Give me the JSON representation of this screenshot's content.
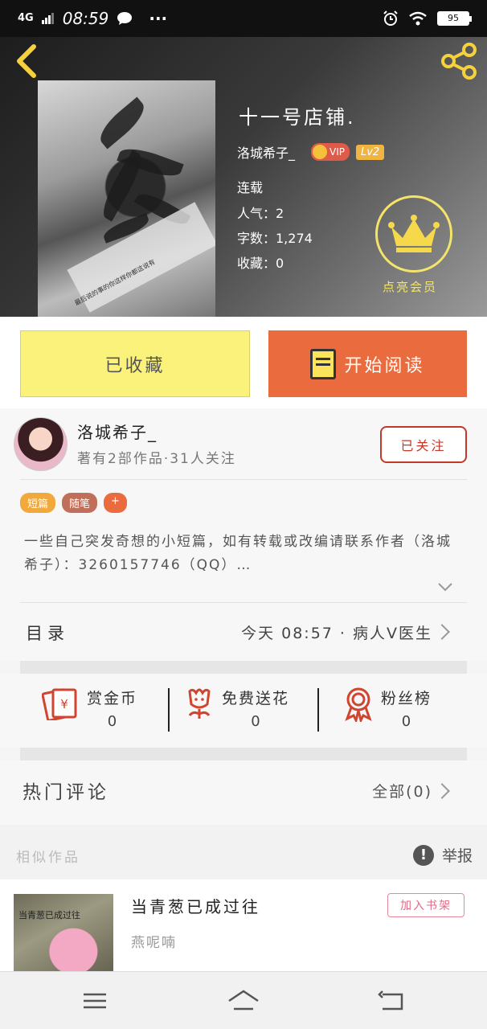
{
  "status_bar": {
    "network": "4G",
    "time": "08:59",
    "more": "···",
    "battery": "95"
  },
  "book": {
    "title": "十一号店铺.",
    "author": "洛城希子_",
    "vip_label": "VIP",
    "level": "Lv2",
    "status": "连载",
    "popularity": "人气：2",
    "word_count": "字数：1,274",
    "favorites": "收藏：0",
    "member_label": "点亮会员",
    "cover_text": "最后说的事的你这样你都这说有"
  },
  "actions": {
    "collect_label": "已收藏",
    "read_label": "开始阅读"
  },
  "author_card": {
    "name": "洛城希子_",
    "stats": "著有2部作品·31人关注",
    "follow_label": "已关注"
  },
  "tags": [
    {
      "label": "短篇",
      "color": "#f2a93b"
    },
    {
      "label": "随笔",
      "color": "#c0705a"
    },
    {
      "label": "+",
      "color": "#ea6b3d"
    }
  ],
  "description": "一些自己突发奇想的小短篇，如有转载或改编请联系作者（洛城希子）：3260157746（QQ）…",
  "catalog": {
    "label": "目录",
    "latest": "今天 08:57 · 病人V医生"
  },
  "rewards": [
    {
      "label": "赏金币",
      "value": "0",
      "icon": "red-envelope-icon"
    },
    {
      "label": "免费送花",
      "value": "0",
      "icon": "flower-icon"
    },
    {
      "label": "粉丝榜",
      "value": "0",
      "icon": "medal-icon"
    }
  ],
  "comments": {
    "label": "热门评论",
    "all_label": "全部(0)"
  },
  "similar": {
    "label": "相似作品",
    "report_label": "举报",
    "item": {
      "title": "当青葱已成过往",
      "author": "燕呢喃",
      "cover_text": "当青葱已成过往",
      "shelf_label": "加入书架"
    }
  },
  "colors": {
    "accent_yellow": "#f5d23c",
    "read_button": "#ea6b3d",
    "collect_button": "#faf27a",
    "follow_red": "#c0392b"
  }
}
